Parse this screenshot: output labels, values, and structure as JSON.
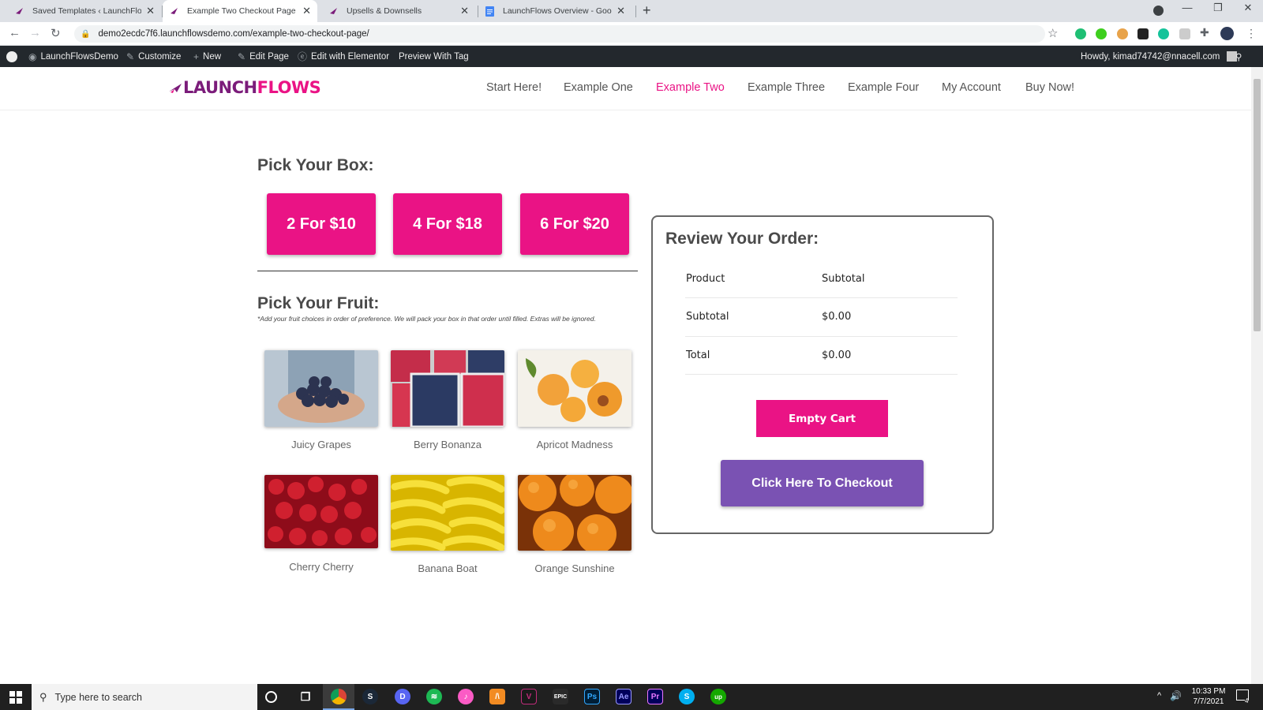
{
  "browser": {
    "tabs": [
      {
        "title": "Saved Templates ‹ LaunchFlowsD",
        "active": false
      },
      {
        "title": "Example Two Checkout Page – La",
        "active": true
      },
      {
        "title": "Upsells & Downsells",
        "active": false
      },
      {
        "title": "LaunchFlows Overview - Google",
        "active": false
      }
    ],
    "url": "demo2ecdc7f6.launchflowsdemo.com/example-two-checkout-page/"
  },
  "admin_bar": {
    "site_name": "LaunchFlowsDemo",
    "customize": "Customize",
    "new": "New",
    "edit_page": "Edit Page",
    "edit_elementor": "Edit with Elementor",
    "preview": "Preview With Tag",
    "howdy": "Howdy, kimad74742@nnacell.com"
  },
  "site": {
    "logo_part1": "LAUNCH",
    "logo_part2": "FLOWS",
    "menu": [
      "Start Here!",
      "Example One",
      "Example Two",
      "Example Three",
      "Example Four",
      "My Account",
      "Buy Now!"
    ],
    "current_menu": "Example Two"
  },
  "main": {
    "box_heading": "Pick Your Box:",
    "boxes": [
      "2 For $10",
      "4 For $18",
      "6 For $20"
    ],
    "fruit_heading": "Pick Your Fruit:",
    "fruit_note": "*Add your fruit choices in order of preference. We will pack your box in that order until filled. Extras will be ignored.",
    "fruits": [
      "Juicy Grapes",
      "Berry Bonanza",
      "Apricot Madness",
      "Cherry Cherry",
      "Banana Boat",
      "Orange Sunshine"
    ]
  },
  "order": {
    "heading": "Review Your Order:",
    "col_product": "Product",
    "col_subtotal": "Subtotal",
    "subtotal_label": "Subtotal",
    "subtotal_value": "$0.00",
    "total_label": "Total",
    "total_value": "$0.00",
    "empty_cart": "Empty Cart",
    "checkout": "Click Here To Checkout"
  },
  "taskbar": {
    "search_placeholder": "Type here to search",
    "time": "10:33 PM",
    "date": "7/7/2021",
    "notifications": "4"
  },
  "colors": {
    "brand_pink": "#ea1385",
    "brand_purple": "#7a52b3",
    "logo_purple": "#7b1c7a"
  }
}
